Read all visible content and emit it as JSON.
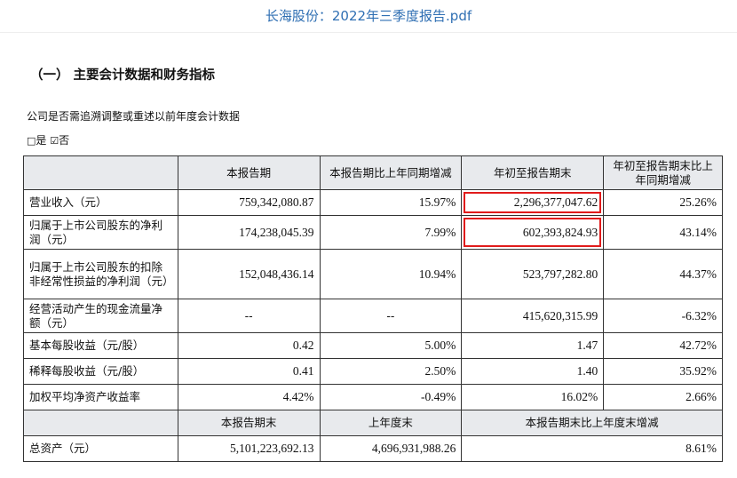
{
  "viewer": {
    "title": "长海股份：2022年三季度报告.pdf"
  },
  "doc": {
    "section_title": "（一）  主要会计数据和财务指标",
    "para1": "公司是否需追溯调整或重述以前年度会计数据",
    "options": {
      "yes_mark": "□",
      "yes_label": "是",
      "no_mark": "☑",
      "no_label": "否"
    }
  },
  "table": {
    "header1": [
      "",
      "本报告期",
      "本报告期比上年同期增减",
      "年初至报告期末",
      "年初至报告期末比上年同期增减"
    ],
    "rows": [
      {
        "label": "营业收入（元）",
        "cells": [
          "759,342,080.87",
          "15.97%",
          "2,296,377,047.62",
          "25.26%"
        ]
      },
      {
        "label": "归属于上市公司股东的净利润（元）",
        "cells": [
          "174,238,045.39",
          "7.99%",
          "602,393,824.93",
          "43.14%"
        ]
      },
      {
        "label": "归属于上市公司股东的扣除非经常性损益的净利润（元）",
        "cells": [
          "152,048,436.14",
          "10.94%",
          "523,797,282.80",
          "44.37%"
        ]
      },
      {
        "label": "经营活动产生的现金流量净额（元）",
        "cells": [
          "--",
          "--",
          "415,620,315.99",
          "-6.32%"
        ]
      },
      {
        "label": "基本每股收益（元/股）",
        "cells": [
          "0.42",
          "5.00%",
          "1.47",
          "42.72%"
        ]
      },
      {
        "label": "稀释每股收益（元/股）",
        "cells": [
          "0.41",
          "2.50%",
          "1.40",
          "35.92%"
        ]
      },
      {
        "label": "加权平均净资产收益率",
        "cells": [
          "4.42%",
          "-0.49%",
          "16.02%",
          "2.66%"
        ]
      }
    ],
    "header2": [
      "",
      "本报告期末",
      "上年度末",
      "本报告期末比上年度末增减"
    ],
    "total_row": {
      "label": "总资产（元）",
      "cells": [
        "5,101,223,692.13",
        "4,696,931,988.26",
        "8.61%"
      ]
    }
  },
  "highlight_color": "#e11b1b"
}
